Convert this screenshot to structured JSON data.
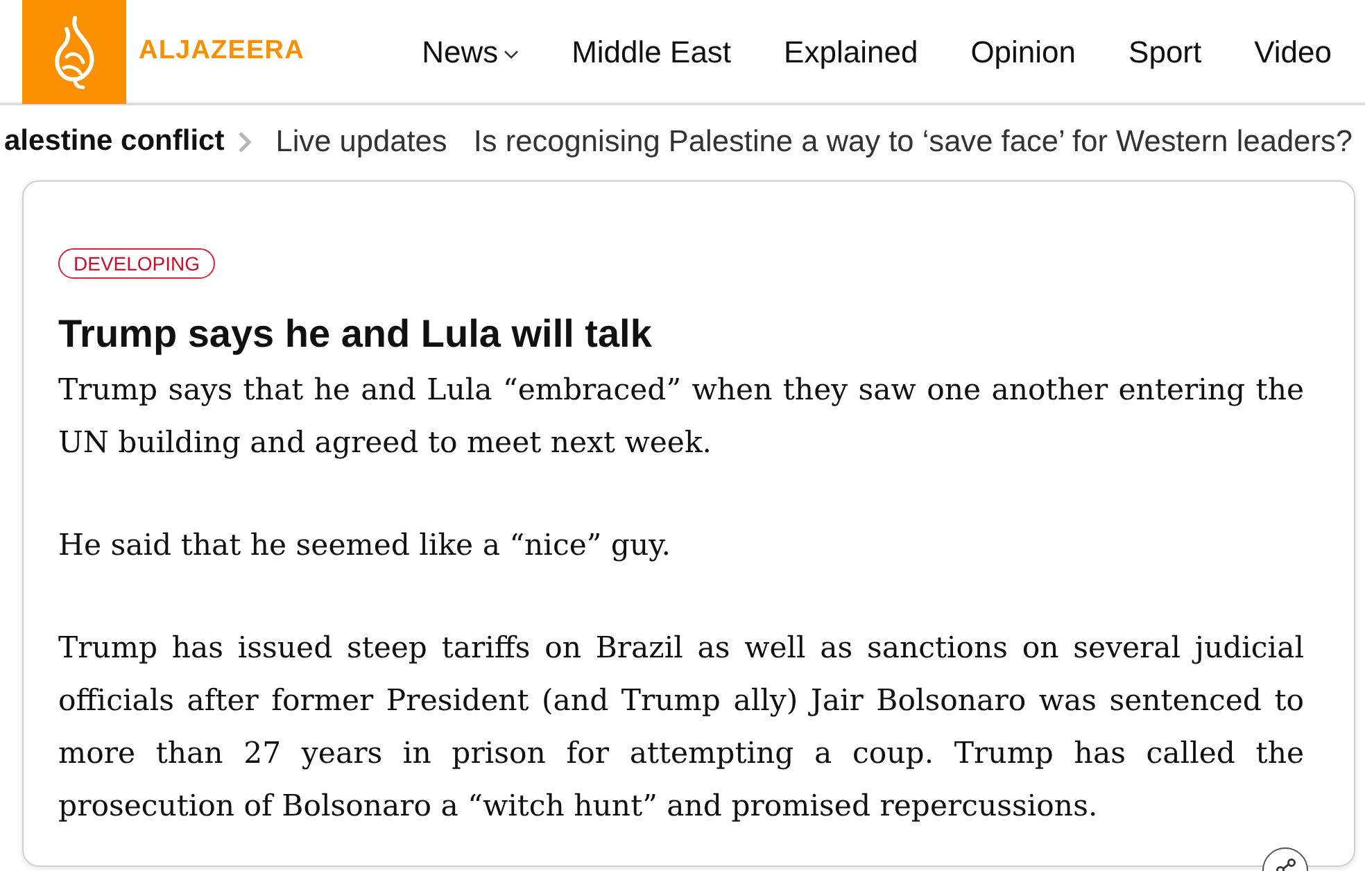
{
  "header": {
    "logo_text": "ALJAZEERA",
    "nav": [
      {
        "label": "News",
        "kind": "dropdown"
      },
      {
        "label": "Middle East",
        "kind": "link"
      },
      {
        "label": "Explained",
        "kind": "link"
      },
      {
        "label": "Opinion",
        "kind": "link"
      },
      {
        "label": "Sport",
        "kind": "link"
      },
      {
        "label": "Video",
        "kind": "link"
      }
    ]
  },
  "breadcrumb": {
    "section": "alestine conflict",
    "links": [
      "Live updates",
      "Is recognising Palestine a way to ‘save face’ for Western leaders?"
    ]
  },
  "post": {
    "badge": "DEVELOPING",
    "title": "Trump says he and Lula will talk",
    "paragraphs": [
      "Trump says that he and Lula “embraced” when they saw one another entering the UN building and agreed to meet next week.",
      "He said that he seemed like a “nice” guy.",
      "Trump has issued steep tariffs on Brazil as well as sanctions on several judicial officials after former President (and Trump ally) Jair Bolsonaro was sentenced to more than 27 years in prison for attempting a coup. Trump has called the prosecution of Bolsonaro a “witch hunt” and promised repercussions."
    ]
  }
}
